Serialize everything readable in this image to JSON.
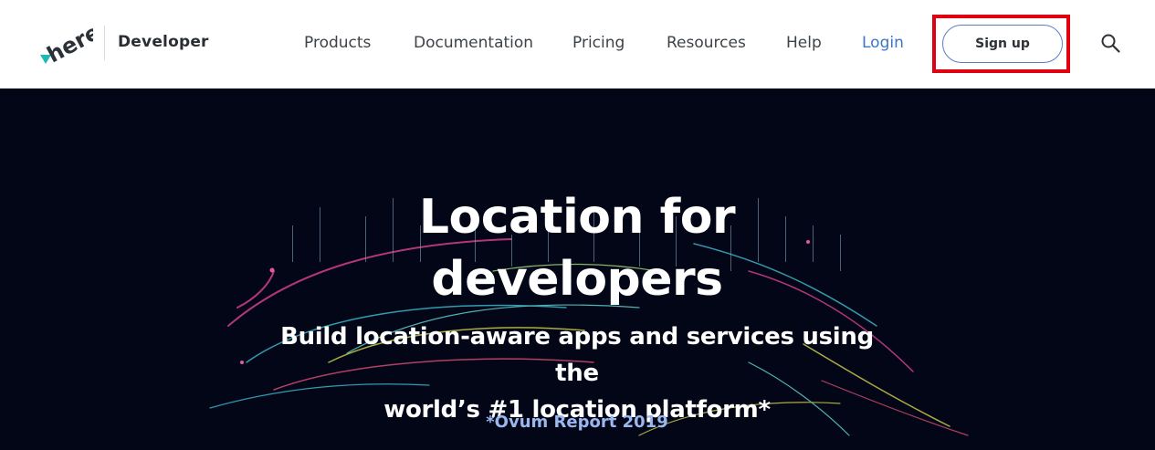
{
  "header": {
    "brand_label": "Developer",
    "logo_text": "here",
    "nav": [
      {
        "label": "Products"
      },
      {
        "label": "Documentation"
      },
      {
        "label": "Pricing"
      },
      {
        "label": "Resources"
      },
      {
        "label": "Help"
      },
      {
        "label": "Login"
      }
    ],
    "signup_label": "Sign up",
    "search_icon": "search-icon"
  },
  "hero": {
    "title_line1": "Location for",
    "title_line2": "developers",
    "subtitle_line1": "Build location-aware apps and services using the",
    "subtitle_line2": "world’s #1 location platform*",
    "note": "*Ovum Report 2019"
  },
  "colors": {
    "accent_link": "#3b76c9",
    "hero_background": "#020617",
    "highlight": "#e1000f",
    "logo_teal": "#1fb8b8"
  }
}
